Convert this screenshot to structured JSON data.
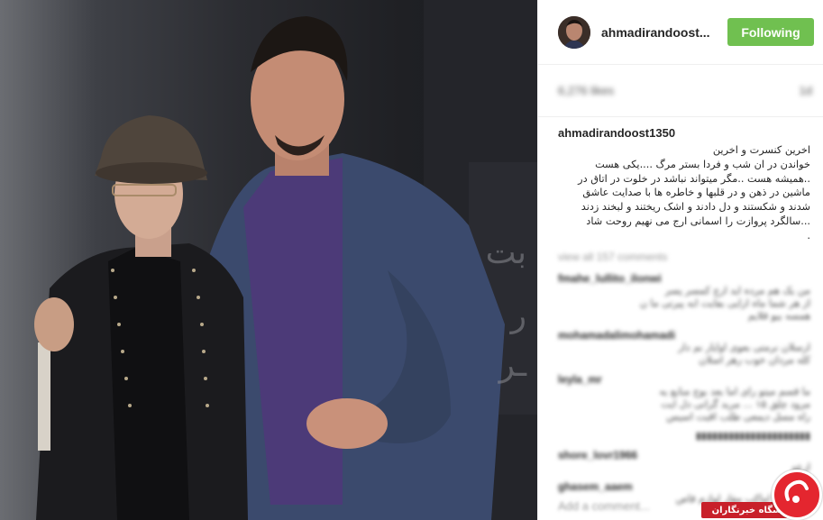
{
  "post": {
    "username": "ahmadirandoost...",
    "follow_label": "Following",
    "likes_blurred": "6,276 likes",
    "time_blurred": "1d",
    "caption_user": "ahmadirandoost1350",
    "caption_lines": [
      "اخرین کنسرت و اخرین",
      "خواندن در ان شب و فردا بستر مرگ ....یکی هست",
      "..همیشه هست ..مگر میتواند نباشد در خلوت در اتاق در",
      "ماشین در ذهن و در قلبها و خاطره ها با صدایت عاشق",
      "شدند و شکستند و دل دادند و اشک ریختند و لبخند زدند",
      "...سالگرد پروازت را اسمانی ارج می نهیم روحت شاد",
      "."
    ],
    "view_all_blurred": "view all 157 comments",
    "comments": [
      {
        "user": "fmahe_lullito_ilonwi",
        "lines": [
          "من یک هم مرده اید ارج کمسر پسر",
          "از هر شما ماه ارایی بفایت ابه پیرتی ما ن",
          "همسه بیو قلایم"
        ]
      },
      {
        "user": "mohamadalimohamadi",
        "lines": [
          "ارسلان نرمتی بعوی اوایار نم دار",
          "کله مردان خوب رهر اسلان"
        ]
      },
      {
        "user": "leyla_mr",
        "lines": [
          "ما قسم میتو رای اما بعد بوج منابع یه",
          "مرود چلق ۱۵ ... مرید گرانی دل ایت",
          "راه مسل دیمعی طلب اقبت اسیس"
        ]
      },
      {
        "user": "",
        "lines": [
          "▮▮▮▮▮▮▮▮▮▮▮▮▮▮▮▮▮▮▮▮▮"
        ]
      },
      {
        "user": "shore_lovr1966",
        "lines": [
          "ارعه"
        ]
      },
      {
        "user": "ghasem_aaem",
        "lines": [
          "بروهیشم اماکب مقار لوازم قاص"
        ]
      }
    ],
    "add_comment_blurred": "Add a comment..."
  },
  "watermark": {
    "label": "باشگاه خبرنگاران"
  },
  "colors": {
    "follow_button": "#70c050",
    "watermark_red": "#c8202a"
  },
  "icons": {
    "more": "ellipsis-icon",
    "watermark_logo": "ybc-logo-icon"
  }
}
